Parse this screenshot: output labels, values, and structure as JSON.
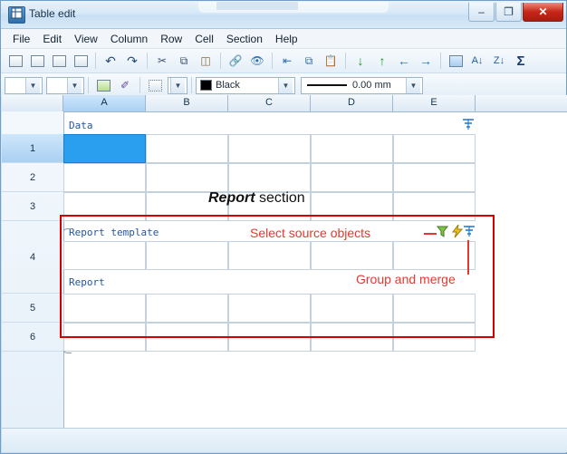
{
  "window": {
    "title": "Table edit",
    "app_icon": "table-app-icon",
    "buttons": {
      "minimize": "–",
      "maximize": "❐",
      "close": "✕"
    }
  },
  "menu": {
    "items": [
      "File",
      "Edit",
      "View",
      "Column",
      "Row",
      "Cell",
      "Section",
      "Help"
    ]
  },
  "toolbar1": {
    "items": [
      {
        "name": "grid-insert-icon",
        "glyph": "▦"
      },
      {
        "name": "insert-row-icon",
        "glyph": "▤"
      },
      {
        "name": "insert-column-icon",
        "glyph": "▥"
      },
      {
        "name": "merge-cells-icon",
        "glyph": "▧"
      },
      {
        "name": "undo-icon",
        "glyph": "↶"
      },
      {
        "name": "redo-icon",
        "glyph": "↷"
      },
      {
        "name": "cut-icon",
        "glyph": "✂"
      },
      {
        "name": "copy-icon",
        "glyph": "⧉"
      },
      {
        "name": "paste-icon",
        "glyph": "📋"
      },
      {
        "name": "visibility-icon",
        "glyph": "👁"
      },
      {
        "name": "move-down-icon",
        "glyph": "↓"
      },
      {
        "name": "move-up-icon",
        "glyph": "↑"
      },
      {
        "name": "move-left-icon",
        "glyph": "←"
      },
      {
        "name": "move-right-icon",
        "glyph": "→"
      },
      {
        "name": "table-properties-icon",
        "glyph": "▦"
      },
      {
        "name": "sort-ascending-icon",
        "glyph": "A↓"
      },
      {
        "name": "sort-descending-icon",
        "glyph": "Z↓"
      },
      {
        "name": "sum-icon",
        "glyph": "Σ"
      }
    ]
  },
  "toolbar2": {
    "font_style_combo": "",
    "size_combo": "",
    "color_label": "Black",
    "line_width_label": "0.00 mm"
  },
  "sheet": {
    "columns": [
      "A",
      "B",
      "C",
      "D",
      "E"
    ],
    "selected_column": "A",
    "rows": [
      "1",
      "2",
      "3",
      "4",
      "5",
      "6"
    ],
    "selected_row": "1",
    "data_label": "Data",
    "report_template_label": "Report template",
    "report_label": "Report"
  },
  "annotations": {
    "report_section_prefix": "Report",
    "report_section_suffix": " section",
    "select_source_objects": "Select source objects",
    "group_and_merge": "Group and merge",
    "accent_color": "#e03a2f",
    "border_color": "#d40000"
  },
  "icons": {
    "data_section_icon": "merge-section-icon",
    "filter_icon": "funnel-filter-icon",
    "lightning_icon": "lightning-bolt-icon",
    "merge_icon": "group-merge-icon"
  }
}
